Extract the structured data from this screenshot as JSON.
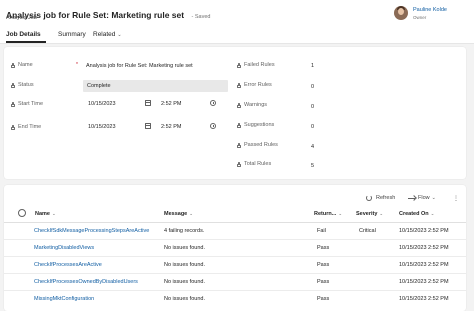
{
  "header": {
    "title": "Analysis job for Rule Set: Marketing rule set",
    "saved_status": "- Saved",
    "subtitle": "Analysis Job",
    "owner_name": "Pauline Kolde",
    "owner_role": "Owner"
  },
  "tabs": [
    {
      "label": "Job Details",
      "active": true
    },
    {
      "label": "Summary",
      "active": false
    },
    {
      "label": "Related",
      "active": false
    }
  ],
  "form": {
    "name_label": "Name",
    "name_value": "Analysis job for Rule Set: Marketing rule set",
    "status_label": "Status",
    "status_value": "Complete",
    "start_label": "Start Time",
    "start_date": "10/15/2023",
    "start_time": "2:52 PM",
    "end_label": "End Time",
    "end_date": "10/15/2023",
    "end_time": "2:52 PM",
    "required_marker": "*"
  },
  "rule_counts": [
    {
      "label": "Failed Rules",
      "value": "1"
    },
    {
      "label": "Error Rules",
      "value": "0"
    },
    {
      "label": "Warnings",
      "value": "0"
    },
    {
      "label": "Suggestions",
      "value": "0"
    },
    {
      "label": "Passed Rules",
      "value": "4"
    },
    {
      "label": "Total Rules",
      "value": "5"
    }
  ],
  "toolbar": {
    "refresh_label": "Refresh",
    "flow_label": "Flow"
  },
  "table": {
    "columns": [
      "Name",
      "Message",
      "Return...",
      "Severity",
      "Created On"
    ],
    "rows": [
      {
        "name": "CheckIfSdkMessageProcessingStepsAreActive",
        "message": "4 failing records.",
        "result": "Fail",
        "severity": "Critical",
        "created": "10/15/2023 2:52 PM"
      },
      {
        "name": "MarketingDisabledViews",
        "message": "No issues found.",
        "result": "Pass",
        "severity": "",
        "created": "10/15/2023 2:52 PM"
      },
      {
        "name": "CheckIfProcessesAreActive",
        "message": "No issues found.",
        "result": "Pass",
        "severity": "",
        "created": "10/15/2023 2:52 PM"
      },
      {
        "name": "CheckIfProcessesOwnedByDisabledUsers",
        "message": "No issues found.",
        "result": "Pass",
        "severity": "",
        "created": "10/15/2023 2:52 PM"
      },
      {
        "name": "MissingMktConfiguration",
        "message": "No issues found.",
        "result": "Pass",
        "severity": "",
        "created": "10/15/2023 2:52 PM"
      }
    ]
  },
  "icons": [
    "lock-icon",
    "calendar-icon",
    "clock-icon",
    "refresh-icon",
    "flow-icon",
    "chevron-down-icon",
    "more-icon",
    "select-all-icon",
    "sort-icon"
  ],
  "colors": {
    "link": "#115ea3",
    "required": "#c50f1f",
    "readonly_field": "#e8e8e8"
  }
}
